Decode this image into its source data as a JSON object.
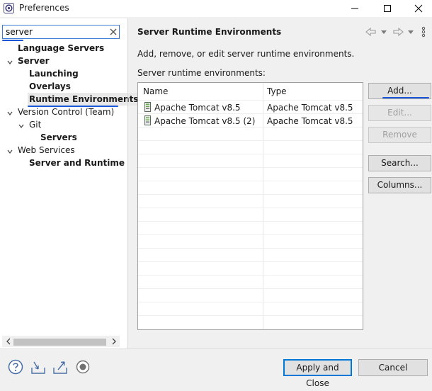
{
  "window": {
    "title": "Preferences"
  },
  "filter": {
    "value": "server"
  },
  "tree": {
    "items": [
      {
        "label": "Language Servers",
        "bold": true
      },
      {
        "label": "Server",
        "bold": true
      },
      {
        "label": "Launching",
        "bold": true
      },
      {
        "label": "Overlays",
        "bold": true
      },
      {
        "label": "Runtime Environments",
        "bold": true,
        "selected": true
      },
      {
        "label": "Version Control (Team)",
        "bold": false
      },
      {
        "label": "Git",
        "bold": false
      },
      {
        "label": "Servers",
        "bold": true
      },
      {
        "label": "Web Services",
        "bold": false
      },
      {
        "label": "Server and Runtime",
        "bold": true
      }
    ]
  },
  "page": {
    "title": "Server Runtime Environments",
    "description": "Add, remove, or edit server runtime environments.",
    "list_label": "Server runtime environments:"
  },
  "table": {
    "columns": [
      "Name",
      "Type"
    ],
    "rows": [
      {
        "name": "Apache Tomcat v8.5",
        "type": "Apache Tomcat v8.5"
      },
      {
        "name": "Apache Tomcat v8.5 (2)",
        "type": "Apache Tomcat v8.5"
      }
    ]
  },
  "buttons": {
    "add": "Add...",
    "edit": "Edit...",
    "remove": "Remove",
    "search": "Search...",
    "columns": "Columns..."
  },
  "footer": {
    "apply_close": "Apply and Close",
    "cancel": "Cancel"
  },
  "colors": {
    "accent": "#1a56d6",
    "focus_border": "#0078d7"
  }
}
